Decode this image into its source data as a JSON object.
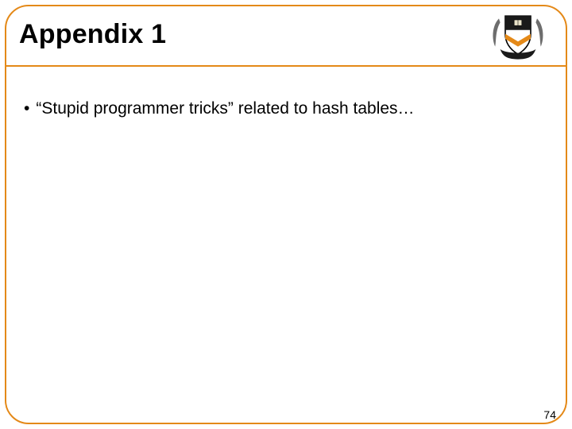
{
  "title": "Appendix 1",
  "bullets": [
    "“Stupid programmer tricks” related to hash tables…"
  ],
  "page_number": "74",
  "logo": {
    "alt": "princeton-shield-icon",
    "colors": {
      "shield_top": "#1a1a1a",
      "shield_bottom": "#ffffff",
      "chevron": "#e48918",
      "banner": "#1a1a1a",
      "foliage": "#6d6d6d"
    }
  }
}
